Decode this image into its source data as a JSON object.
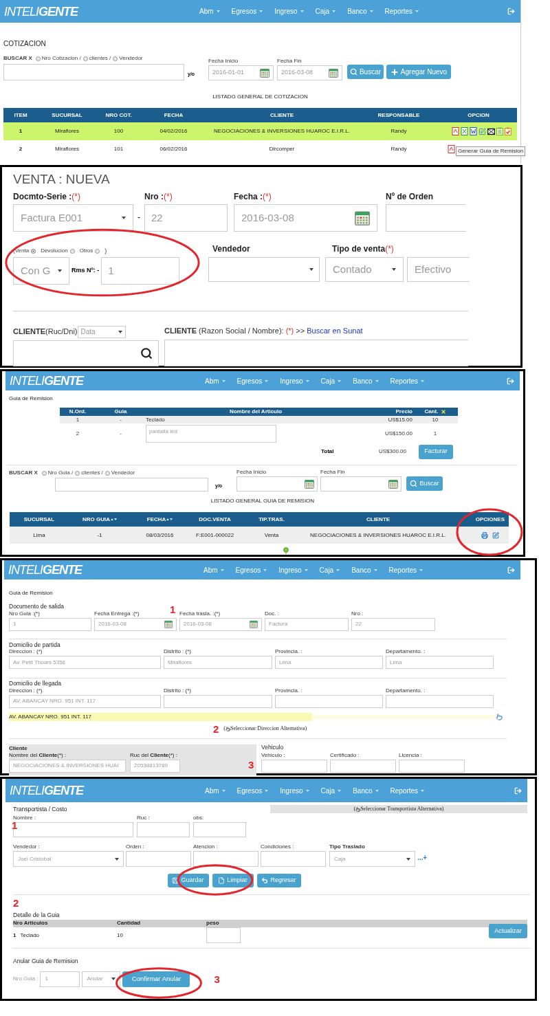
{
  "cotizacion_panel": {
    "navbar": {
      "brand_light": "INTELI",
      "brand_bold": "GENTE",
      "menu": [
        "Abm",
        "Egresos",
        "Ingreso",
        "Caja",
        "Banco",
        "Reportes"
      ]
    },
    "title": "COTIZACION",
    "search": {
      "label": "BUSCAR X",
      "options": [
        {
          "label": "Nro Cotizacion /",
          "selected": false
        },
        {
          "label": "clientes /",
          "selected": false
        },
        {
          "label": "Vendedor",
          "selected": false
        }
      ],
      "connector": "y/o",
      "date_from": {
        "label": "Fecha Inicio",
        "value": "2016-01-01"
      },
      "date_to": {
        "label": "Fecha Fin",
        "value": "2016-03-08"
      },
      "buttons": [
        {
          "label": "Buscar",
          "kind": "search"
        },
        {
          "label": "Agregar Nuevo",
          "kind": "add"
        }
      ]
    },
    "list_title": "LISTADO GENERAL DE COTIZACION",
    "table": {
      "columns": [
        "ITEM",
        "SUCURSAL",
        "NRO COT.",
        "FECHA",
        "CLIENTE",
        "RESPONSABLE",
        "OPCION"
      ],
      "rows": [
        {
          "cells": [
            "1",
            "Miraflores",
            "100",
            "04/02/2016",
            "NEGOCIACIONES & INVERSIONES HUAROC E.I.R.L.",
            "Randy"
          ],
          "selected": true
        },
        {
          "cells": [
            "2",
            "Miraflores",
            "101",
            "06/02/2016",
            "Dircomper",
            "Randy"
          ],
          "selected": false
        }
      ]
    },
    "tooltip": "Generar Guia de Remision"
  },
  "venta_panel": {
    "title": "VENTA : NUEVA",
    "docmto": {
      "label": "Docmto-Serie :",
      "required": "(*)",
      "value": "Factura E001"
    },
    "separator": "-",
    "nro": {
      "label": "Nro :",
      "required": "(*)",
      "value": "22"
    },
    "fecha": {
      "label": "Fecha :",
      "required": "(*)",
      "value": "2016-03-08"
    },
    "orden": {
      "label": "Nº de Orden"
    },
    "tipo_doc": {
      "options": [
        {
          "label": "(Venta",
          "selected": true
        },
        {
          "label": "Devolucion",
          "selected": false
        },
        {
          "label": "Otros",
          "selected": false
        }
      ],
      "close": ")"
    },
    "guia_select": {
      "value": "Con G"
    },
    "rms": {
      "label": "Rms Nº: -",
      "value": "1"
    },
    "vendedor": {
      "label": "Vendedor"
    },
    "tipo_venta": {
      "label": "Tipo de venta",
      "required": "(*)",
      "value": "Contado",
      "pago": "Efectivo"
    },
    "cliente_doc": {
      "label": "**CLIENTE**(Ruc/Dni)",
      "select": "Data"
    },
    "cliente_nombre": {
      "label": "**CLIENTE** (Razon Social / Nombre):",
      "required": "(*)",
      "suffix": ">>",
      "link": "Buscar en Sunat"
    }
  },
  "guia_list_panel": {
    "navbar": {
      "brand_light": "INTELI",
      "brand_bold": "GENTE",
      "menu": [
        "Abm",
        "Egresos",
        "Ingreso",
        "Caja",
        "Banco",
        "Reportes"
      ]
    },
    "title": "Guia de Remision",
    "items": {
      "columns": [
        "N.Ord.",
        "Guia",
        "Nombre del Articulo",
        "Precio",
        "Cant."
      ],
      "rows": [
        {
          "kind": "text",
          "cells": [
            "1",
            "-",
            "Teclado",
            "US$15.00",
            "10"
          ]
        },
        {
          "kind": "textarea",
          "cells": [
            "2",
            "-",
            "pantalla led",
            "US$150.00",
            "1"
          ]
        }
      ],
      "total_label": "Total",
      "total": "US$300.00",
      "button": "Facturar"
    },
    "search": {
      "label": "BUSCAR X",
      "options": [
        {
          "label": "Nro Guia /",
          "selected": false
        },
        {
          "label": "clientes /",
          "selected": false
        },
        {
          "label": "Vendedor",
          "selected": false
        }
      ],
      "connector": "y/o",
      "date_from": {
        "label": "Fecha Inicio"
      },
      "date_to": {
        "label": "Fecha Fin"
      },
      "button": {
        "label": "Buscar",
        "kind": "search"
      }
    },
    "list_title": "LISTADO GENERAL GUIA DE REMISION",
    "table": {
      "columns": [
        {
          "label": "SUCURSAL",
          "sortable": false
        },
        {
          "label": "NRO GUIA",
          "sortable": true
        },
        {
          "label": "FECHA",
          "sortable": true
        },
        {
          "label": "DOC.VENTA",
          "sortable": false
        },
        {
          "label": "TIP.TRAS.",
          "sortable": false
        },
        {
          "label": "CLIENTE",
          "sortable": false
        },
        {
          "label": "OPCIONES",
          "sortable": false
        }
      ],
      "rows": [
        {
          "cells": [
            "Lima",
            "-1",
            "08/03/2016",
            "F:E001-000022",
            "Venta",
            "NEGOCIACIONES & INVERSIONES HUAROC E.I.R.L."
          ]
        }
      ]
    }
  },
  "guia_form_panel": {
    "navbar": {
      "brand_light": "INTELI",
      "brand_bold": "GENTE",
      "menu": [
        "Abm",
        "Egresos",
        "Ingreso",
        "Caja",
        "Banco",
        "Reportes"
      ]
    },
    "title": "Guia de Remision",
    "documento": {
      "title": "Documento de salida",
      "fields": [
        {
          "label": "Nro Guia :(*)",
          "value": "1",
          "kind": "text"
        },
        {
          "label": "Fecha Entrega :(*)",
          "value": "2016-03-08",
          "kind": "date"
        },
        {
          "label": "Fecha trasla. :(*)",
          "value": "2016-03-08",
          "kind": "date"
        },
        {
          "label": "Doc. :",
          "value": "Factura",
          "kind": "text"
        },
        {
          "label": "Nro :",
          "value": "22",
          "kind": "text"
        }
      ]
    },
    "partida": {
      "title": "Domicilio de partida",
      "fields": [
        {
          "label": "Direccion : (*)",
          "value": "Av. Petit Thoars 5356"
        },
        {
          "label": "Distrito : (*)",
          "value": "Miraflores"
        },
        {
          "label": "Provincia. :",
          "value": "Lima"
        },
        {
          "label": "Departamento. :",
          "value": "Lima"
        }
      ]
    },
    "llegada": {
      "title": "Domicilio de llegada",
      "fields": [
        {
          "label": "Direccion : (*)",
          "value": "AV. ABANCAY NRO. 951 INT. 117"
        },
        {
          "label": "Distrito : (*)"
        },
        {
          "label": "Provincia. :"
        },
        {
          "label": "Departamento. :"
        }
      ]
    },
    "suggestion": "AV. ABANCAY NRO. 951 INT. 117",
    "alt_link": {
      "prefix": "(",
      "label": "Seleccionar Direccion Alternativa)"
    },
    "cliente": {
      "title": "Cliente",
      "fields": [
        {
          "label": "Nombre del **Cliente**(*) :",
          "value": "NEGOCIACIONES & INVERSIONES HUAI"
        },
        {
          "label": "Ruc del **Cliente**(*) :",
          "value": "20538813789"
        }
      ]
    },
    "vehiculo": {
      "title": "Vehiculo",
      "fields": [
        {
          "label": "Vehiculo :"
        },
        {
          "label": "Certificado :"
        },
        {
          "label": "Licencia :"
        }
      ]
    },
    "annotations": [
      "1",
      "2",
      "3"
    ]
  },
  "transporte_panel": {
    "navbar": {
      "brand_light": "INTELI",
      "brand_bold": "GENTE",
      "menu": [
        "Abm",
        "Egresos",
        "Ingreso",
        "Caja",
        "Banco",
        "Reportes"
      ]
    },
    "title": "Transportista / Costo",
    "alt_link": {
      "prefix": "(",
      "label": "Seleccionar Transportista Alternativa)"
    },
    "fields": [
      {
        "label": "Nombre :"
      },
      {
        "label": "Ruc :"
      },
      {
        "label": "obs:"
      }
    ],
    "vendedor": {
      "label": "Vendedor :",
      "value": "Joel Cristobal"
    },
    "others": [
      {
        "label": "Orden :"
      },
      {
        "label": "Atencion :"
      },
      {
        "label": "Condiciones :"
      }
    ],
    "traslado": {
      "label": "Tipo Traslado",
      "value": "Caja",
      "more": "...+"
    },
    "buttons": [
      {
        "label": "Guardar",
        "kind": "save"
      },
      {
        "label": "Limpiar",
        "kind": "file"
      },
      {
        "label": "Regresar",
        "kind": "undo"
      }
    ],
    "detalle": {
      "title": "Detalle de la Guia",
      "columns": [
        "Nro Articulos",
        "Cantidad",
        "peso"
      ],
      "rows": [
        {
          "number": "1",
          "articulo": "Teclado",
          "cantidad": "10"
        }
      ],
      "button": "Actualizar"
    },
    "anular": {
      "title": "Anular Guia de Remision",
      "label": "Nro Guia :",
      "value": "1",
      "select": "Anular",
      "button": "Confirmar Anular"
    },
    "annotations": [
      "1",
      "2",
      "3"
    ]
  }
}
